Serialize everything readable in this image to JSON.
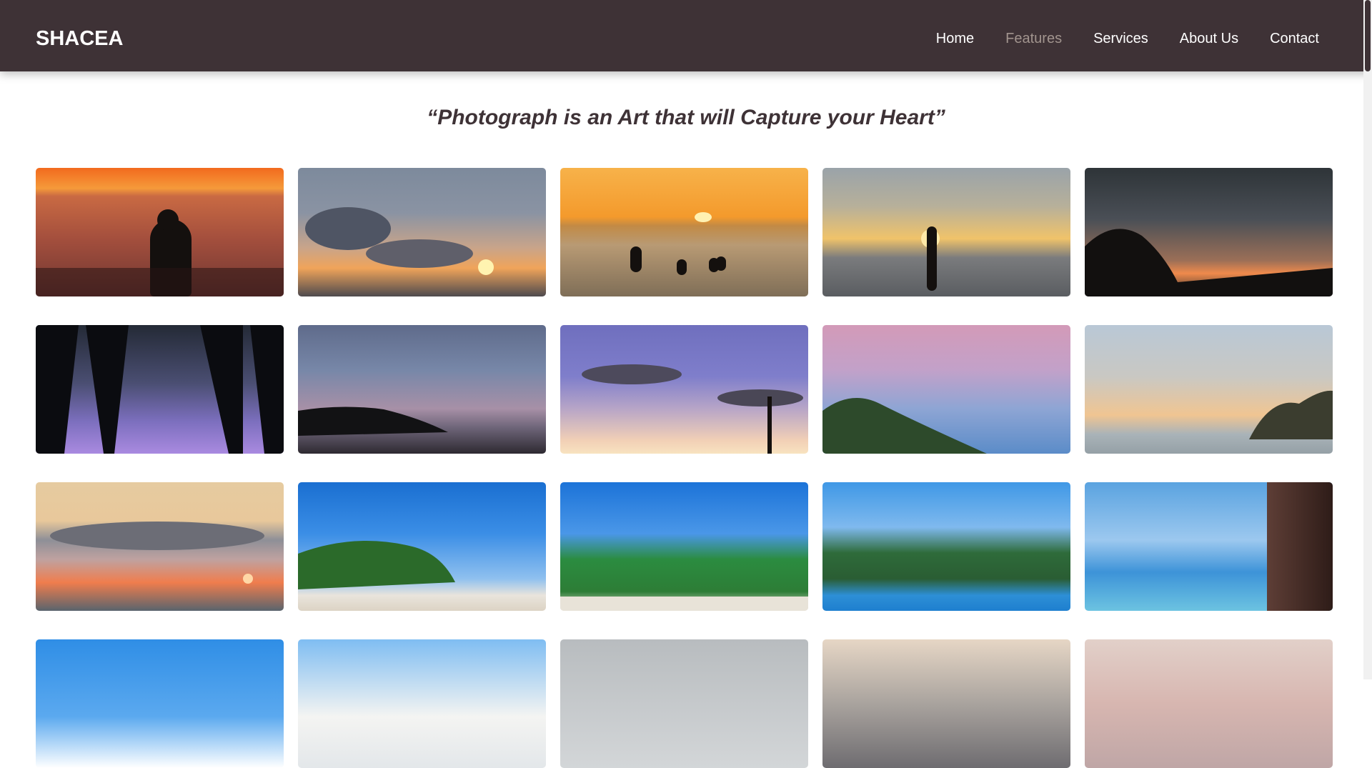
{
  "nav": {
    "brand": "SHACEA",
    "links": [
      "Home",
      "Features",
      "Services",
      "About Us",
      "Contact"
    ],
    "active": "Features"
  },
  "quote": "“Photograph is an Art that will Capture your Heart”",
  "colors": {
    "navbar_bg": "#3e3236",
    "nav_active": "#a1948e",
    "quote_text": "#3e3236"
  },
  "gallery": {
    "photos": [
      {
        "subject": "sunset-woman-sea"
      },
      {
        "subject": "clouds-sunset-sea"
      },
      {
        "subject": "golden-sunset-swimmers"
      },
      {
        "subject": "silhouette-woman-beach"
      },
      {
        "subject": "headland-dusk"
      },
      {
        "subject": "palm-silhouettes-purple-sky"
      },
      {
        "subject": "island-dusk-sky"
      },
      {
        "subject": "purple-clouds-powerlines"
      },
      {
        "subject": "pink-clouds-palms"
      },
      {
        "subject": "pastel-sky-cliff"
      },
      {
        "subject": "city-sunset-clouds"
      },
      {
        "subject": "blue-sky-beach"
      },
      {
        "subject": "tropical-palms-beach"
      },
      {
        "subject": "harbor-hills-boats"
      },
      {
        "subject": "window-view-palm-sea"
      },
      {
        "subject": "blue-sky-clouds"
      },
      {
        "subject": "white-clouds-blue-sky"
      },
      {
        "subject": "grey-sky"
      },
      {
        "subject": "dusky-clouds"
      },
      {
        "subject": "pink-clouds"
      }
    ]
  }
}
